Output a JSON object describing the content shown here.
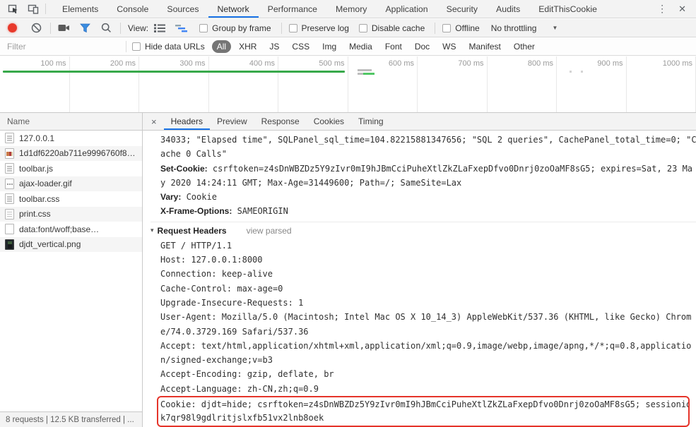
{
  "colors": {
    "accent_blue": "#1a73e8",
    "record_red": "#e8392b",
    "filter_blue": "#3b8de0",
    "timeline_green": "#38a94b",
    "highlight_red": "#e5342a",
    "selected_pill_bg": "#757575"
  },
  "tabbar": {
    "tabs": [
      {
        "label": "Elements"
      },
      {
        "label": "Console"
      },
      {
        "label": "Sources"
      },
      {
        "label": "Network"
      },
      {
        "label": "Performance"
      },
      {
        "label": "Memory"
      },
      {
        "label": "Application"
      },
      {
        "label": "Security"
      },
      {
        "label": "Audits"
      },
      {
        "label": "EditThisCookie"
      }
    ],
    "active_tab": "Network",
    "menu_icon": "⋮",
    "close_icon": "✕"
  },
  "toolbar": {
    "view_label": "View:",
    "checkboxes": [
      "Group by frame",
      "Preserve log",
      "Disable cache",
      "Offline"
    ],
    "throttling_value": "No throttling",
    "caret_icon": "▼"
  },
  "filterbar": {
    "placeholder": "Filter",
    "hide_data_urls_label": "Hide data URLs",
    "pills": [
      "All",
      "XHR",
      "JS",
      "CSS",
      "Img",
      "Media",
      "Font",
      "Doc",
      "WS",
      "Manifest",
      "Other"
    ],
    "selected_pill": "All"
  },
  "timeline": {
    "ticks": [
      "100 ms",
      "200 ms",
      "300 ms",
      "400 ms",
      "500 ms",
      "600 ms",
      "700 ms",
      "800 ms",
      "900 ms",
      "1000 ms"
    ]
  },
  "requests": {
    "header": "Name",
    "items": [
      {
        "name": "127.0.0.1",
        "icon": "document"
      },
      {
        "name": "1d1df6220ab711e9996760f8…",
        "icon": "image"
      },
      {
        "name": "toolbar.js",
        "icon": "document"
      },
      {
        "name": "ajax-loader.gif",
        "icon": "image-dots"
      },
      {
        "name": "toolbar.css",
        "icon": "document"
      },
      {
        "name": "print.css",
        "icon": "document"
      },
      {
        "name": "data:font/woff;base…",
        "icon": "plain"
      },
      {
        "name": "djdt_vertical.png",
        "icon": "image-dark"
      }
    ]
  },
  "status": "8 requests | 12.5 KB transferred | ...",
  "detail": {
    "close_icon": "×",
    "tabs": [
      "Headers",
      "Preview",
      "Response",
      "Cookies",
      "Timing"
    ],
    "active_tab": "Headers"
  },
  "headers": {
    "response_lines": [
      {
        "name": "",
        "value": "34033; \"Elapsed time\", SQLPanel_sql_time=104.82215881347656; \"SQL 2 queries\", CachePanel_total_time=0; \"C"
      },
      {
        "name": "",
        "value": "ache 0 Calls\""
      },
      {
        "name": "Set-Cookie:",
        "value": " csrftoken=z4sDnWBZDz5Y9zIvr0mI9hJBmCciPuheXtlZkZLaFxepDfvo0Dnrj0zoOaMF8sG5; expires=Sat, 23 Ma"
      },
      {
        "name": "",
        "value": "y 2020 14:24:11 GMT; Max-Age=31449600; Path=/; SameSite=Lax"
      },
      {
        "name": "Vary:",
        "value": " Cookie"
      },
      {
        "name": "X-Frame-Options:",
        "value": " SAMEORIGIN"
      }
    ],
    "section": {
      "arrow": "▾",
      "title": "Request Headers",
      "link": "view parsed"
    },
    "request_lines": [
      "GET / HTTP/1.1",
      "Host: 127.0.0.1:8000",
      "Connection: keep-alive",
      "Cache-Control: max-age=0",
      "Upgrade-Insecure-Requests: 1",
      "User-Agent: Mozilla/5.0 (Macintosh; Intel Mac OS X 10_14_3) AppleWebKit/537.36 (KHTML, like Gecko) Chrom",
      "e/74.0.3729.169 Safari/537.36",
      "Accept: text/html,application/xhtml+xml,application/xml;q=0.9,image/webp,image/apng,*/*;q=0.8,applicatio",
      "n/signed-exchange;v=b3",
      "Accept-Encoding: gzip, deflate, br",
      "Accept-Language: zh-CN,zh;q=0.9"
    ],
    "cookie_lines": [
      "Cookie: djdt=hide; csrftoken=z4sDnWBZDz5Y9zIvr0mI9hJBmCciPuheXtlZkZLaFxepDfvo0Dnrj0zoOaMF8sG5; sessionid=",
      "k7qr98l9gdlritjslxfb51vx2lnb8oek"
    ]
  }
}
